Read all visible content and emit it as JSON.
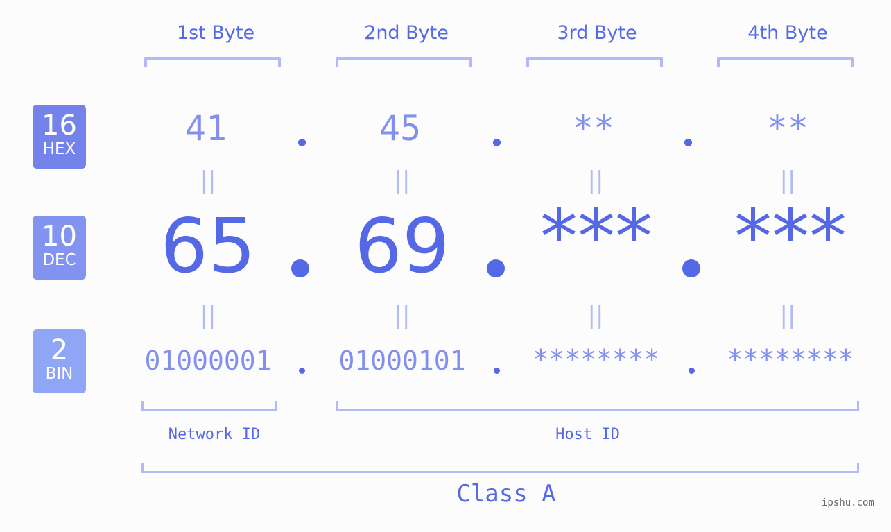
{
  "bytes": [
    {
      "label": "1st Byte",
      "hex": "41",
      "dec": "65",
      "bin": "01000001"
    },
    {
      "label": "2nd Byte",
      "hex": "45",
      "dec": "69",
      "bin": "01000101"
    },
    {
      "label": "3rd Byte",
      "hex": "**",
      "dec": "***",
      "bin": "********"
    },
    {
      "label": "4th Byte",
      "hex": "**",
      "dec": "***",
      "bin": "********"
    }
  ],
  "badges": {
    "hex": {
      "num": "16",
      "label": "HEX",
      "color": "#7383ea"
    },
    "dec": {
      "num": "10",
      "label": "DEC",
      "color": "#8393f0"
    },
    "bin": {
      "num": "2",
      "label": "BIN",
      "color": "#8fa6f7"
    }
  },
  "equals_glyph": "||",
  "sections": {
    "network": "Network ID",
    "host": "Host ID",
    "class": "Class A"
  },
  "watermark": "ipshu.com",
  "colors": {
    "primary": "#5568e6",
    "secondary": "#8190ee",
    "bracket": "#b2bbf5",
    "background": "#fbfcfb"
  }
}
